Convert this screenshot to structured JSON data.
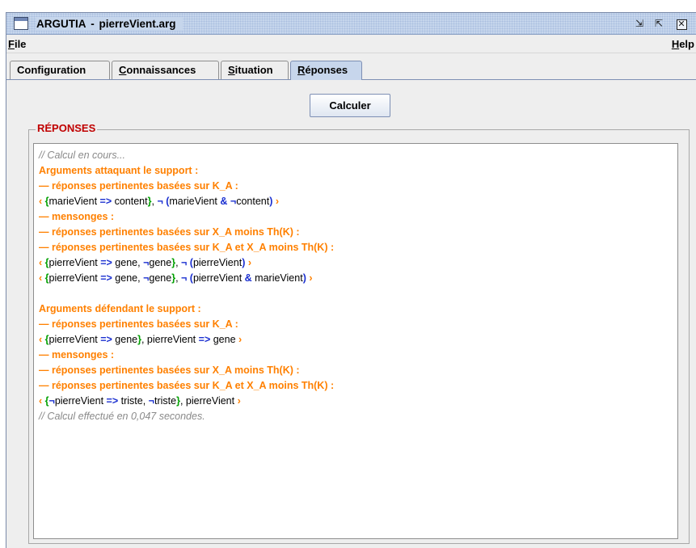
{
  "window": {
    "app_name": "ARGUTIA",
    "separator": "-",
    "file_name": "pierreVient.arg",
    "controls": {
      "iconify": "⇲",
      "maximize": "⇱",
      "close": "✕"
    }
  },
  "menubar": {
    "file": {
      "mnemonic": "F",
      "rest": "ile"
    },
    "help": {
      "mnemonic": "H",
      "rest": "elp"
    }
  },
  "tabs": [
    {
      "pre": "",
      "mnemonic": "",
      "rest": "Configuration",
      "selected": false
    },
    {
      "pre": "",
      "mnemonic": "C",
      "rest": "onnaissances",
      "selected": false
    },
    {
      "pre": "",
      "mnemonic": "S",
      "rest": "ituation",
      "selected": false
    },
    {
      "pre": "",
      "mnemonic": "R",
      "rest": "éponses",
      "selected": true
    }
  ],
  "panel": {
    "calc_button": "Calculer",
    "group_title": "RÉPONSES"
  },
  "output_lines": [
    [
      {
        "t": "// Calcul en cours...",
        "s": "comment"
      }
    ],
    [
      {
        "t": "Arguments attaquant le support :",
        "s": "head"
      }
    ],
    [
      {
        "t": "— réponses pertinentes basées sur K_A :",
        "s": "head"
      }
    ],
    [
      {
        "t": "‹ ",
        "s": "o"
      },
      {
        "t": "{",
        "s": "g"
      },
      {
        "t": "marieVient ",
        "s": "t"
      },
      {
        "t": "=>",
        "s": "b"
      },
      {
        "t": " content",
        "s": "t"
      },
      {
        "t": "}",
        "s": "g"
      },
      {
        "t": ", ",
        "s": "t"
      },
      {
        "t": "¬ (",
        "s": "b"
      },
      {
        "t": "marieVient ",
        "s": "t"
      },
      {
        "t": "&",
        "s": "b"
      },
      {
        "t": " ¬",
        "s": "b"
      },
      {
        "t": "content",
        "s": "t"
      },
      {
        "t": ")",
        "s": "b"
      },
      {
        "t": " ›",
        "s": "o"
      }
    ],
    [
      {
        "t": "— mensonges :",
        "s": "head"
      }
    ],
    [
      {
        "t": "— réponses pertinentes basées sur X_A moins Th(K) :",
        "s": "head"
      }
    ],
    [
      {
        "t": "— réponses pertinentes basées sur K_A et X_A moins Th(K) :",
        "s": "head"
      }
    ],
    [
      {
        "t": "‹ ",
        "s": "o"
      },
      {
        "t": "{",
        "s": "g"
      },
      {
        "t": "pierreVient ",
        "s": "t"
      },
      {
        "t": "=>",
        "s": "b"
      },
      {
        "t": " gene, ",
        "s": "t"
      },
      {
        "t": "¬",
        "s": "b"
      },
      {
        "t": "gene",
        "s": "t"
      },
      {
        "t": "}",
        "s": "g"
      },
      {
        "t": ", ",
        "s": "t"
      },
      {
        "t": "¬ (",
        "s": "b"
      },
      {
        "t": "pierreVient",
        "s": "t"
      },
      {
        "t": ")",
        "s": "b"
      },
      {
        "t": " ›",
        "s": "o"
      }
    ],
    [
      {
        "t": "‹ ",
        "s": "o"
      },
      {
        "t": "{",
        "s": "g"
      },
      {
        "t": "pierreVient ",
        "s": "t"
      },
      {
        "t": "=>",
        "s": "b"
      },
      {
        "t": " gene, ",
        "s": "t"
      },
      {
        "t": "¬",
        "s": "b"
      },
      {
        "t": "gene",
        "s": "t"
      },
      {
        "t": "}",
        "s": "g"
      },
      {
        "t": ", ",
        "s": "t"
      },
      {
        "t": "¬ (",
        "s": "b"
      },
      {
        "t": "pierreVient ",
        "s": "t"
      },
      {
        "t": "&",
        "s": "b"
      },
      {
        "t": " marieVient",
        "s": "t"
      },
      {
        "t": ")",
        "s": "b"
      },
      {
        "t": " ›",
        "s": "o"
      }
    ],
    [],
    [
      {
        "t": "Arguments défendant le support :",
        "s": "head"
      }
    ],
    [
      {
        "t": "— réponses pertinentes basées sur K_A :",
        "s": "head"
      }
    ],
    [
      {
        "t": "‹ ",
        "s": "o"
      },
      {
        "t": "{",
        "s": "g"
      },
      {
        "t": "pierreVient ",
        "s": "t"
      },
      {
        "t": "=>",
        "s": "b"
      },
      {
        "t": " gene",
        "s": "t"
      },
      {
        "t": "}",
        "s": "g"
      },
      {
        "t": ", pierreVient ",
        "s": "t"
      },
      {
        "t": "=>",
        "s": "b"
      },
      {
        "t": " gene",
        "s": "t"
      },
      {
        "t": " ›",
        "s": "o"
      }
    ],
    [
      {
        "t": "— mensonges :",
        "s": "head"
      }
    ],
    [
      {
        "t": "— réponses pertinentes basées sur X_A moins Th(K) :",
        "s": "head"
      }
    ],
    [
      {
        "t": "— réponses pertinentes basées sur K_A et X_A moins Th(K) :",
        "s": "head"
      }
    ],
    [
      {
        "t": "‹ ",
        "s": "o"
      },
      {
        "t": "{",
        "s": "g"
      },
      {
        "t": "¬",
        "s": "b"
      },
      {
        "t": "pierreVient ",
        "s": "t"
      },
      {
        "t": "=>",
        "s": "b"
      },
      {
        "t": " triste, ",
        "s": "t"
      },
      {
        "t": "¬",
        "s": "b"
      },
      {
        "t": "triste",
        "s": "t"
      },
      {
        "t": "}",
        "s": "g"
      },
      {
        "t": ", pierreVient",
        "s": "t"
      },
      {
        "t": " ›",
        "s": "o"
      }
    ],
    [
      {
        "t": "// Calcul effectué en 0,047 secondes.",
        "s": "comment"
      }
    ]
  ],
  "colors": {
    "title_bar": "#c6d6ec",
    "selected_tab": "#c7d6ec",
    "group_title": "#c00000",
    "heading_text": "#ff8000",
    "braces": "#00a000",
    "operators": "#1a2fd0",
    "comment": "#8a8a8a"
  }
}
